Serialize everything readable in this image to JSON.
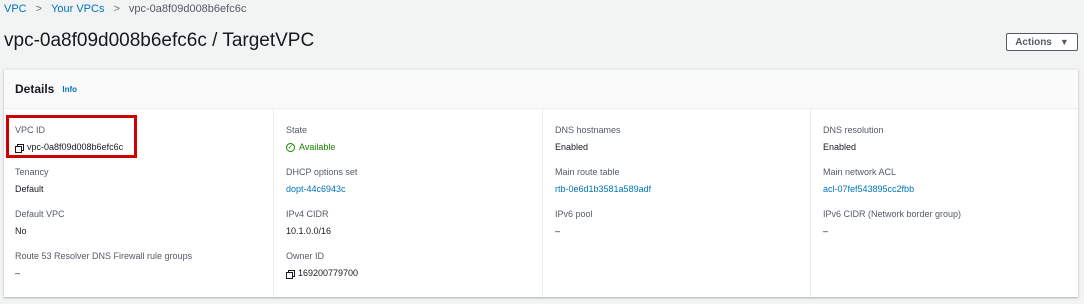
{
  "breadcrumb": {
    "items": [
      "VPC",
      "Your VPCs",
      "vpc-0a8f09d008b6efc6c"
    ]
  },
  "header": {
    "title": "vpc-0a8f09d008b6efc6c / TargetVPC",
    "actions_label": "Actions"
  },
  "details": {
    "title": "Details",
    "info": "Info",
    "columns": [
      [
        {
          "label": "VPC ID",
          "value": "vpc-0a8f09d008b6efc6c"
        },
        {
          "label": "Tenancy",
          "value": "Default"
        },
        {
          "label": "Default VPC",
          "value": "No"
        },
        {
          "label": "Route 53 Resolver DNS Firewall rule groups",
          "value": "–"
        }
      ],
      [
        {
          "label": "State",
          "value": "Available"
        },
        {
          "label": "DHCP options set",
          "value": "dopt-44c6943c"
        },
        {
          "label": "IPv4 CIDR",
          "value": "10.1.0.0/16"
        },
        {
          "label": "Owner ID",
          "value": "169200779700"
        }
      ],
      [
        {
          "label": "DNS hostnames",
          "value": "Enabled"
        },
        {
          "label": "Main route table",
          "value": "rtb-0e6d1b3581a589adf"
        },
        {
          "label": "IPv6 pool",
          "value": "–"
        }
      ],
      [
        {
          "label": "DNS resolution",
          "value": "Enabled"
        },
        {
          "label": "Main network ACL",
          "value": "acl-07fef543895cc2fbb"
        },
        {
          "label": "IPv6 CIDR (Network border group)",
          "value": "–"
        }
      ]
    ]
  },
  "colors": {
    "link": "#0073bb",
    "success": "#1d8102",
    "highlight": "#d00000"
  }
}
